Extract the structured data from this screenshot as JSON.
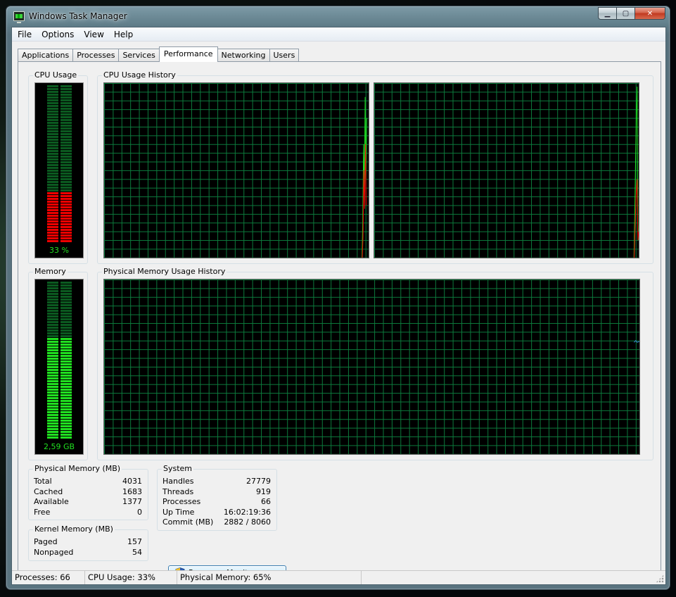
{
  "window": {
    "title": "Windows Task Manager"
  },
  "caption": {
    "min": "▁",
    "max": "▢",
    "close": "✕"
  },
  "menu": [
    "File",
    "Options",
    "View",
    "Help"
  ],
  "tabs": [
    "Applications",
    "Processes",
    "Services",
    "Performance",
    "Networking",
    "Users"
  ],
  "active_tab": "Performance",
  "cpu": {
    "label": "CPU Usage",
    "meter_text": "33 %",
    "usage_fraction": 0.33,
    "history_label": "CPU Usage History"
  },
  "memory": {
    "label": "Memory",
    "meter_text": "2,59 GB",
    "usage_fraction": 0.65,
    "history_label": "Physical Memory Usage History"
  },
  "physical_memory": {
    "label": "Physical Memory (MB)",
    "rows": [
      {
        "key": "Total",
        "value": "4031"
      },
      {
        "key": "Cached",
        "value": "1683"
      },
      {
        "key": "Available",
        "value": "1377"
      },
      {
        "key": "Free",
        "value": "0"
      }
    ]
  },
  "kernel_memory": {
    "label": "Kernel Memory (MB)",
    "rows": [
      {
        "key": "Paged",
        "value": "157"
      },
      {
        "key": "Nonpaged",
        "value": "54"
      }
    ]
  },
  "system": {
    "label": "System",
    "rows": [
      {
        "key": "Handles",
        "value": "27779"
      },
      {
        "key": "Threads",
        "value": "919"
      },
      {
        "key": "Processes",
        "value": "66"
      },
      {
        "key": "Up Time",
        "value": "16:02:19:36"
      },
      {
        "key": "Commit (MB)",
        "value": "2882 / 8060"
      }
    ]
  },
  "buttons": {
    "resource_monitor": "Resource Monitor..."
  },
  "status": {
    "processes": "Processes: 66",
    "cpu": "CPU Usage: 33%",
    "memory": "Physical Memory: 65%"
  },
  "colors": {
    "meter_on_cpu": "#ee0000",
    "meter_on_mem": "#20e020",
    "meter_off": "#0b5a20",
    "grid": "#0c7a3c",
    "line_total": "#20e020",
    "line_kernel": "#ee0000"
  }
}
